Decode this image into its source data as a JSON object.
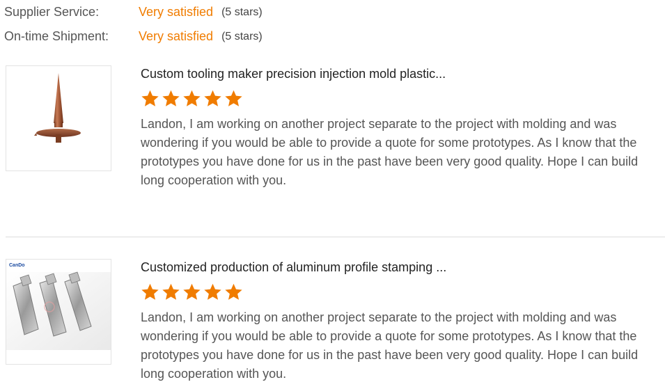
{
  "ratings": [
    {
      "label": "Supplier Service:",
      "value": "Very satisfied",
      "stars": "(5 stars)"
    },
    {
      "label": "On-time Shipment:",
      "value": "Very satisfied",
      "stars": "(5 stars)"
    }
  ],
  "colors": {
    "accent": "#f07c00",
    "star": "#f07c00",
    "text": "#555555",
    "title": "#222222"
  },
  "reviews": [
    {
      "title": "Custom tooling maker precision injection mold plastic...",
      "rating": 5,
      "text": "Landon, I am working on another project separate to the project with molding and was wondering if you would be able to provide a quote for some prototypes. As I know that the prototypes you have done for us in the past have been very good quality. Hope I can build long cooperation with you."
    },
    {
      "title": "Customized production of aluminum profile stamping ...",
      "rating": 5,
      "brand_logo": "CanDo",
      "text": "Landon, I am working on another project separate to the project with molding and was wondering if you would be able to provide a quote for some prototypes. As I know that the prototypes you have done for us in the past have been very good quality. Hope I can build long cooperation with you."
    }
  ]
}
